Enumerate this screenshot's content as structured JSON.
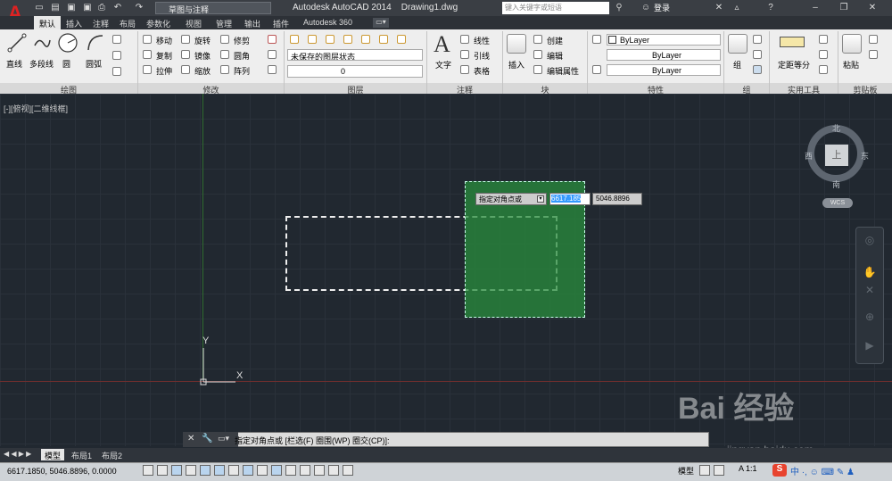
{
  "titlebar": {
    "app_title": "Autodesk AutoCAD 2014",
    "file_name": "Drawing1.dwg",
    "workspace": "草图与注释",
    "search_placeholder": "键入关键字或短语",
    "login": "登录"
  },
  "ribbon_tabs": [
    "默认",
    "插入",
    "注释",
    "布局",
    "参数化",
    "视图",
    "管理",
    "输出",
    "插件",
    "Autodesk 360"
  ],
  "ribbon": {
    "draw": {
      "title": "绘图",
      "line": "直线",
      "polyline": "多段线",
      "circle": "圆",
      "arc": "圆弧"
    },
    "modify": {
      "title": "修改",
      "move": "移动",
      "rotate": "旋转",
      "trim": "修剪",
      "copy": "复制",
      "mirror": "镜像",
      "fillet": "圆角",
      "stretch": "拉伸",
      "scale": "缩放",
      "array": "阵列"
    },
    "layers": {
      "title": "图层",
      "state": "未保存的图层状态",
      "current": "0"
    },
    "annotation": {
      "title": "注释",
      "text": "文字",
      "dimension": "线性",
      "leader": "引线",
      "table": "表格"
    },
    "block": {
      "title": "块",
      "insert": "插入",
      "create": "创建",
      "edit": "编辑",
      "edit_attr": "编辑属性"
    },
    "properties": {
      "title": "特性",
      "color": "ByLayer",
      "linetype": "ByLayer",
      "lineweight": "ByLayer"
    },
    "groups": {
      "title": "组",
      "group": "组"
    },
    "utilities": {
      "title": "实用工具",
      "measure": "定距等分"
    },
    "clipboard": {
      "title": "剪贴板",
      "paste": "粘贴"
    }
  },
  "viewport_label": "[-][俯视][二维线框]",
  "tooltip": {
    "prompt": "指定对角点或",
    "x_value": "6617.185",
    "y_value": "5046.8896"
  },
  "viewcube": {
    "top": "上",
    "north": "北",
    "south": "南",
    "east": "东",
    "west": "西",
    "wcs": "WCS"
  },
  "ucs": {
    "x": "X",
    "y": "Y"
  },
  "command_line": "指定对角点或 [栏选(F) 圈围(WP) 圈交(CP)]:",
  "layout_tabs": [
    "模型",
    "布局1",
    "布局2"
  ],
  "statusbar": {
    "coords": "6617.1850, 5046.8896, 0.0000",
    "model": "模型",
    "scale": "1:1"
  },
  "watermark": {
    "brand": "Bai 经验",
    "url": "jingyan.baidu.com"
  },
  "colors": {
    "selection": "#2e8b3c",
    "canvas": "#212830",
    "accent": "#c0392b"
  }
}
